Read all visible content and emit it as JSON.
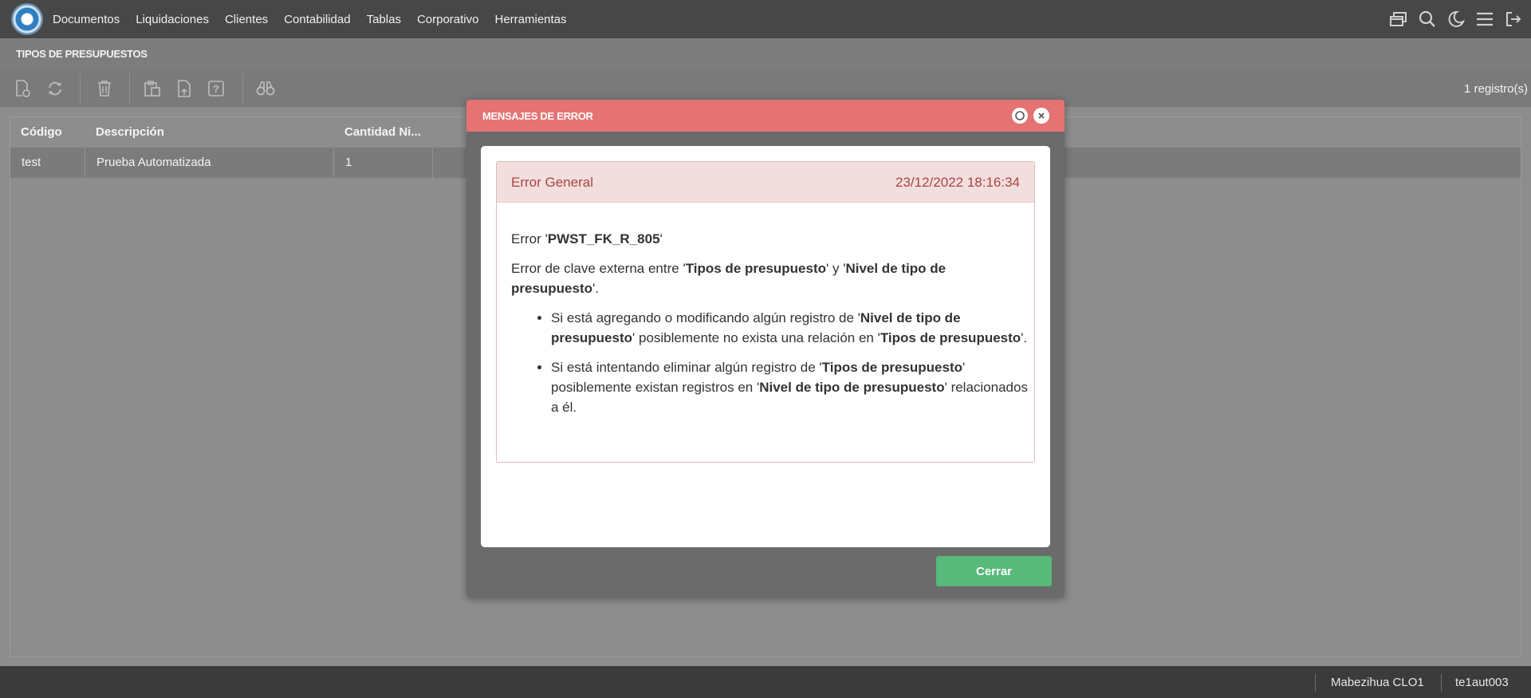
{
  "nav": {
    "items": [
      "Documentos",
      "Liquidaciones",
      "Clientes",
      "Contabilidad",
      "Tablas",
      "Corporativo",
      "Herramientas"
    ],
    "icons": [
      "windows-icon",
      "search-icon",
      "moon-icon",
      "menu-icon",
      "logout-icon"
    ]
  },
  "page": {
    "title": "TIPOS DE PRESUPUESTOS",
    "records": "1 registro(s)"
  },
  "toolbar": {
    "icons": [
      "new-document-icon",
      "refresh-icon",
      "delete-icon",
      "paste-icon",
      "export-icon",
      "help-icon",
      "find-icon"
    ]
  },
  "grid": {
    "columns": [
      "Código",
      "Descripción",
      "Cantidad Ni..."
    ],
    "rows": [
      {
        "codigo": "test",
        "descripcion": "Prueba Automatizada",
        "cantidad": "1"
      }
    ]
  },
  "status": {
    "user": "Mabezihua CLO1",
    "session": "te1aut003"
  },
  "modal": {
    "title": "MENSAJES DE ERROR",
    "alert_title": "Error General",
    "timestamp": "23/12/2022 18:16:34",
    "error_prefix": "Error '",
    "error_code": "PWST_FK_R_805",
    "error_suffix": "'",
    "line1_a": "Error de clave externa entre '",
    "line1_b": "Tipos de presupuesto",
    "line1_c": "' y '",
    "line1_d": "Nivel de tipo de presupuesto",
    "line1_e": "'.",
    "bullet1_a": "Si está agregando o modificando algún registro de '",
    "bullet1_b": "Nivel de tipo de presupuesto",
    "bullet1_c": "' posiblemente no exista una relación en '",
    "bullet1_d": "Tipos de presupuesto",
    "bullet1_e": "'.",
    "bullet2_a": "Si está intentando eliminar algún registro de '",
    "bullet2_b": "Tipos de presupuesto",
    "bullet2_c": "' posiblemente existan registros en '",
    "bullet2_d": "Nivel de tipo de presupuesto",
    "bullet2_e": "' relacionados a él.",
    "close_label": "Cerrar"
  },
  "colors": {
    "modal_header": "#e57373",
    "alert_text": "#a94442",
    "close_button": "#57b97a"
  }
}
